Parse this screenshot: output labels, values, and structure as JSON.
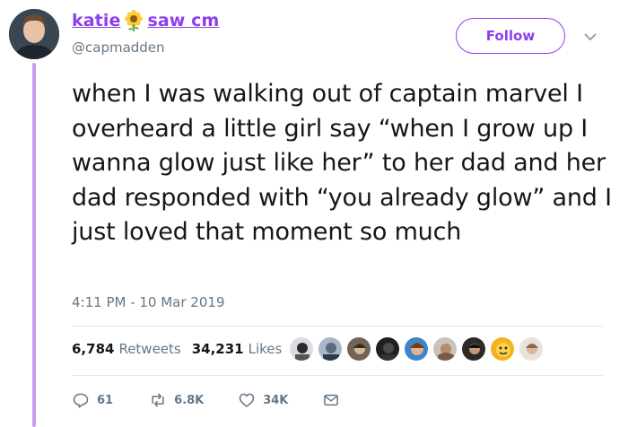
{
  "user": {
    "display_name_part1": "katie",
    "display_name_part2": "saw cm",
    "emoji_icon": "sunflower-icon",
    "handle": "@capmadden"
  },
  "follow_label": "Follow",
  "tweet": {
    "text": "when I was walking out of captain marvel I overheard a little girl say “when I grow up I wanna glow just like her” to her dad and her dad responded with “you already glow” and I just loved that moment so much",
    "timestamp": "4:11 PM - 10 Mar 2019"
  },
  "stats": {
    "retweets_count": "6,784",
    "retweets_label": "Retweets",
    "likes_count": "34,231",
    "likes_label": "Likes"
  },
  "likers": [
    "liker-avatar-1",
    "liker-avatar-2",
    "liker-avatar-3",
    "liker-avatar-4",
    "liker-avatar-5",
    "liker-avatar-6",
    "liker-avatar-7",
    "liker-avatar-8",
    "liker-avatar-9"
  ],
  "actions": {
    "reply_count": "61",
    "retweet_count": "6.8K",
    "like_count": "34K"
  },
  "colors": {
    "brand_purple": "#8d3ff0",
    "thread_line": "#c89cf0",
    "muted_text": "#657786"
  }
}
